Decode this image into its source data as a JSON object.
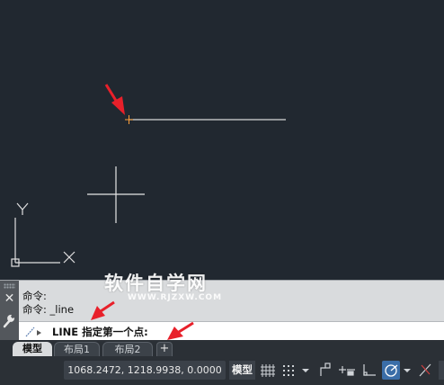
{
  "canvas": {
    "axis_x_label": "X",
    "axis_y_label": "Y"
  },
  "command": {
    "history": [
      "命令:",
      "命令: _line"
    ],
    "prompt_keyword": "LINE",
    "prompt_text": "指定第一个点:"
  },
  "tabs": {
    "items": [
      "模型",
      "布局1",
      "布局2"
    ],
    "active": "模型",
    "add_label": "+"
  },
  "status": {
    "coordinates": "1068.2472, 1218.9938, 0.0000",
    "model_label": "模型"
  },
  "watermark": {
    "title": "软件自学网",
    "url": "WWW.RJZXW.COM"
  },
  "colors": {
    "canvas_bg": "#212830",
    "annotation_arrow": "#e8202a",
    "drawn_line": "#d8d8d8",
    "start_point_marker": "#ff9f3a",
    "watermark": "#ffffff"
  },
  "icons": {
    "close": "close-icon",
    "settings": "wrench-icon",
    "command_line": "command-line-icon",
    "grid": "grid-icon",
    "snap": "snap-icon",
    "infer": "infer-constraints-icon",
    "dynamic": "dynamic-input-icon",
    "ortho": "ortho-icon",
    "polar": "polar-tracking-icon",
    "osnap": "object-snap-icon"
  }
}
